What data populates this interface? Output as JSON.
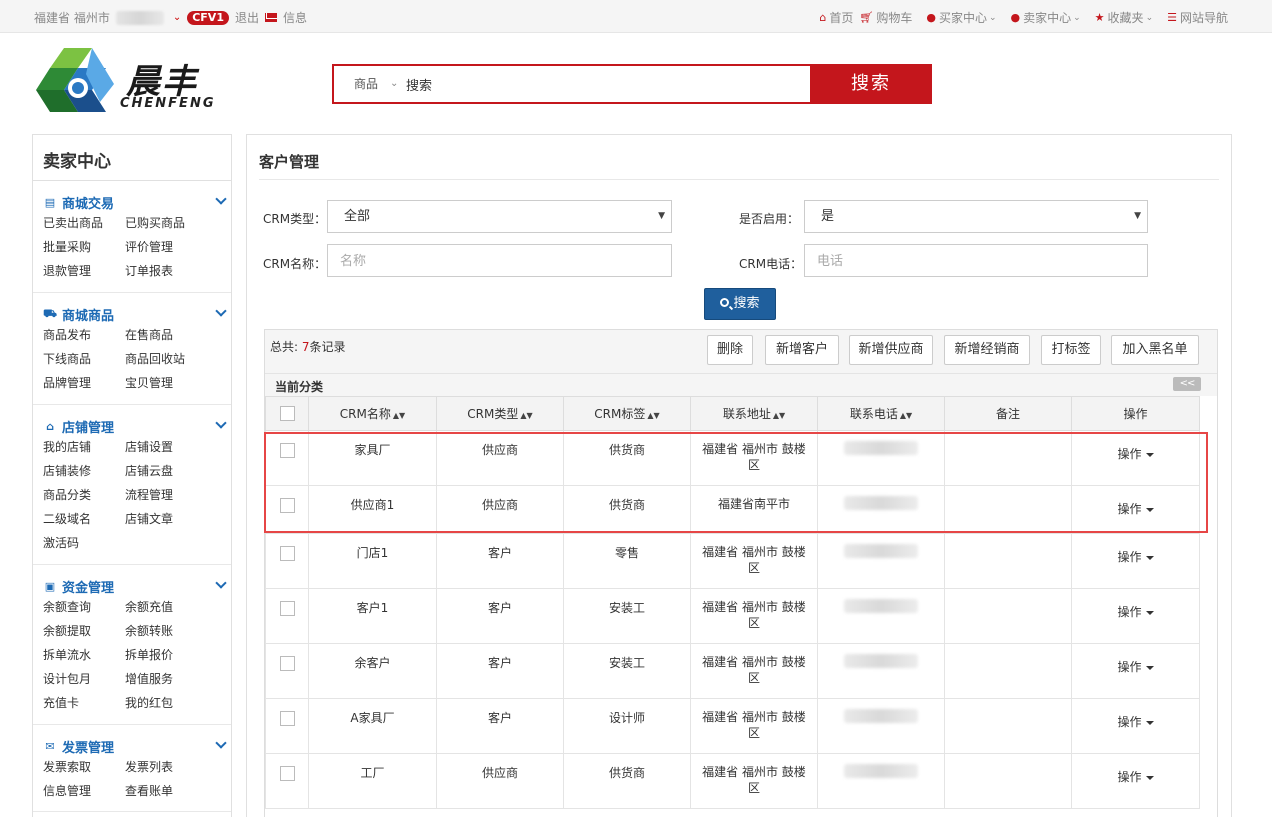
{
  "topbar": {
    "location": "福建省 福州市",
    "badge": "CFV1",
    "logout": "退出",
    "message": "信息",
    "nav": [
      {
        "icon": "home-icon",
        "label": "首页"
      },
      {
        "icon": "cart-icon",
        "label": "购物车"
      },
      {
        "icon": "user-icon",
        "label": "买家中心"
      },
      {
        "icon": "user-icon",
        "label": "卖家中心"
      },
      {
        "icon": "star-icon",
        "label": "收藏夹"
      },
      {
        "icon": "list-icon",
        "label": "网站导航"
      }
    ]
  },
  "logo": {
    "cn": "晨丰",
    "en": "CHENFENG"
  },
  "search": {
    "category": "商品",
    "value": "搜索",
    "button": "搜索"
  },
  "sidebar": {
    "title": "卖家中心",
    "sections": [
      {
        "icon": "card-icon",
        "title": "商城交易",
        "items": [
          "已卖出商品",
          "已购买商品",
          "批量采购",
          "评价管理",
          "退款管理",
          "订单报表"
        ]
      },
      {
        "icon": "truck-icon",
        "title": "商城商品",
        "items": [
          "商品发布",
          "在售商品",
          "下线商品",
          "商品回收站",
          "品牌管理",
          "宝贝管理"
        ]
      },
      {
        "icon": "home-icon",
        "title": "店铺管理",
        "items": [
          "我的店铺",
          "店铺设置",
          "店铺装修",
          "店铺云盘",
          "商品分类",
          "流程管理",
          "二级域名",
          "店铺文章",
          "激活码"
        ]
      },
      {
        "icon": "money-icon",
        "title": "资金管理",
        "items": [
          "余额查询",
          "余额充值",
          "余额提取",
          "余额转账",
          "拆单流水",
          "拆单报价",
          "设计包月",
          "增值服务",
          "充值卡",
          "我的红包"
        ]
      },
      {
        "icon": "envelope-icon",
        "title": "发票管理",
        "items": [
          "发票索取",
          "发票列表",
          "信息管理",
          "查看账单"
        ]
      }
    ]
  },
  "main": {
    "title": "客户管理",
    "filters": {
      "crm_type_label": "CRM类型：",
      "crm_type_value": "全部",
      "enabled_label": "是否启用：",
      "enabled_value": "是",
      "crm_name_label": "CRM名称：",
      "crm_name_placeholder": "名称",
      "crm_phone_label": "CRM电话：",
      "crm_phone_placeholder": "电话",
      "search_button": "搜索"
    },
    "table": {
      "total_prefix": "总共: ",
      "total_count": "7",
      "total_suffix": "条记录",
      "actions": [
        "删除",
        "新增客户",
        "新增供应商",
        "新增经销商",
        "打标签",
        "加入黑名单"
      ],
      "category_label": "当前分类",
      "collapse_label": "<<",
      "columns": [
        "CRM名称",
        "CRM类型",
        "CRM标签",
        "联系地址",
        "联系电话",
        "备注",
        "操作"
      ],
      "op_label": "操作",
      "rows": [
        {
          "name": "家具厂",
          "type": "供应商",
          "tag": "供货商",
          "address": "福建省 福州市 鼓楼区",
          "note": ""
        },
        {
          "name": "供应商1",
          "type": "供应商",
          "tag": "供货商",
          "address": "福建省南平市",
          "note": ""
        },
        {
          "name": "门店1",
          "type": "客户",
          "tag": "零售",
          "address": "福建省 福州市 鼓楼区",
          "note": ""
        },
        {
          "name": "客户1",
          "type": "客户",
          "tag": "安装工",
          "address": "福建省 福州市 鼓楼区",
          "note": ""
        },
        {
          "name": "余客户",
          "type": "客户",
          "tag": "安装工",
          "address": "福建省 福州市 鼓楼区",
          "note": ""
        },
        {
          "name": "A家具厂",
          "type": "客户",
          "tag": "设计师",
          "address": "福建省 福州市 鼓楼区",
          "note": ""
        },
        {
          "name": "工厂",
          "type": "供应商",
          "tag": "供货商",
          "address": "福建省 福州市 鼓楼区",
          "note": ""
        }
      ]
    }
  }
}
